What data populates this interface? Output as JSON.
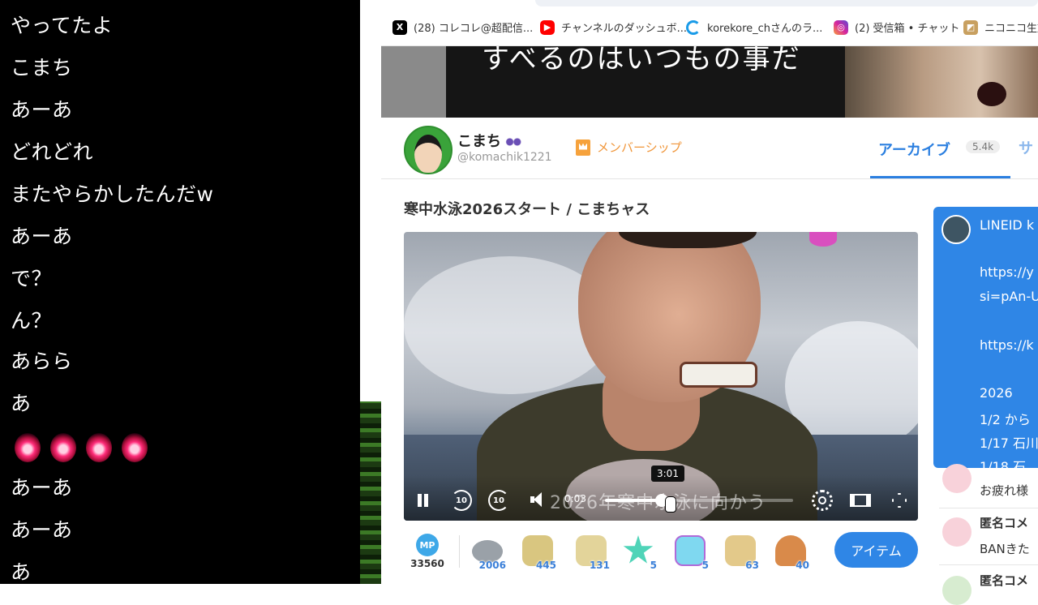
{
  "chat": {
    "messages": [
      "やってたよ",
      "こまち",
      "あーあ",
      "どれどれ",
      "またやらかしたんだw",
      "あーあ",
      "で？",
      "ん？",
      "あらら",
      "あ",
      "",
      "あーあ",
      "あーあ",
      "あ"
    ],
    "emoji_count": 4,
    "emoji_icon": "red-light-emoji"
  },
  "bookmarks": [
    {
      "icon": "x-logo-icon",
      "label": "(28) コレコレ@超配信...",
      "color": "#000000"
    },
    {
      "icon": "youtube-icon",
      "label": "チャンネルのダッシュボ...",
      "color": "#ff0000"
    },
    {
      "icon": "loading-icon",
      "label": "korekore_chさんのラ...",
      "color": "#1a9be8"
    },
    {
      "icon": "instagram-icon",
      "label": "(2) 受信箱 • チャット",
      "color": "#d6249f"
    },
    {
      "icon": "niconico-icon",
      "label": "ニコニコ生放",
      "color": "#c8a060"
    }
  ],
  "banner": {
    "caption": "すべるのはいつもの事だ"
  },
  "profile": {
    "name": "こまち",
    "handle": "@komachik1221",
    "membership_label": "メンバーシップ",
    "tab_archive": "アーカイブ",
    "tab_archive_count": "5.4k",
    "tab_next": "サ"
  },
  "video": {
    "title": "寒中水泳2026スタート / こまちャス",
    "subtitle": "2026年寒中水泳に向かう",
    "current_time": "0:03",
    "hover_time": "3:01",
    "progress": 0.3,
    "rewind_label": "10",
    "forward_label": "10"
  },
  "items": {
    "mp_label": "MP",
    "mp_value": "33560",
    "gifts": [
      {
        "icon": "stone-disc-icon",
        "count": "2006",
        "color": "#9aa1a8"
      },
      {
        "icon": "scroll-icon",
        "count": "445",
        "color": "#d9c680"
      },
      {
        "icon": "scroll-icon",
        "count": "131",
        "color": "#e3d49a"
      },
      {
        "icon": "star-icon",
        "count": "5",
        "color": "#4fd4b8"
      },
      {
        "icon": "ghost-icon",
        "count": "5",
        "color": "#7fd8f0"
      },
      {
        "icon": "scroll-icon",
        "count": "63",
        "color": "#e3c98a"
      },
      {
        "icon": "mushroom-icon",
        "count": "40",
        "color": "#d98a4a"
      }
    ],
    "item_button": "アイテム"
  },
  "description": {
    "lines": [
      "LINEID k",
      "https://y",
      "si=pAn-U",
      "https://k",
      "2026",
      "1/2 から",
      "1/17 石川",
      "1/18 石"
    ]
  },
  "right_comments": [
    {
      "name": "",
      "text": "お疲れ様"
    },
    {
      "name": "匿名コメ",
      "text": "BANきた"
    },
    {
      "name": "匿名コメ",
      "text": ""
    }
  ]
}
